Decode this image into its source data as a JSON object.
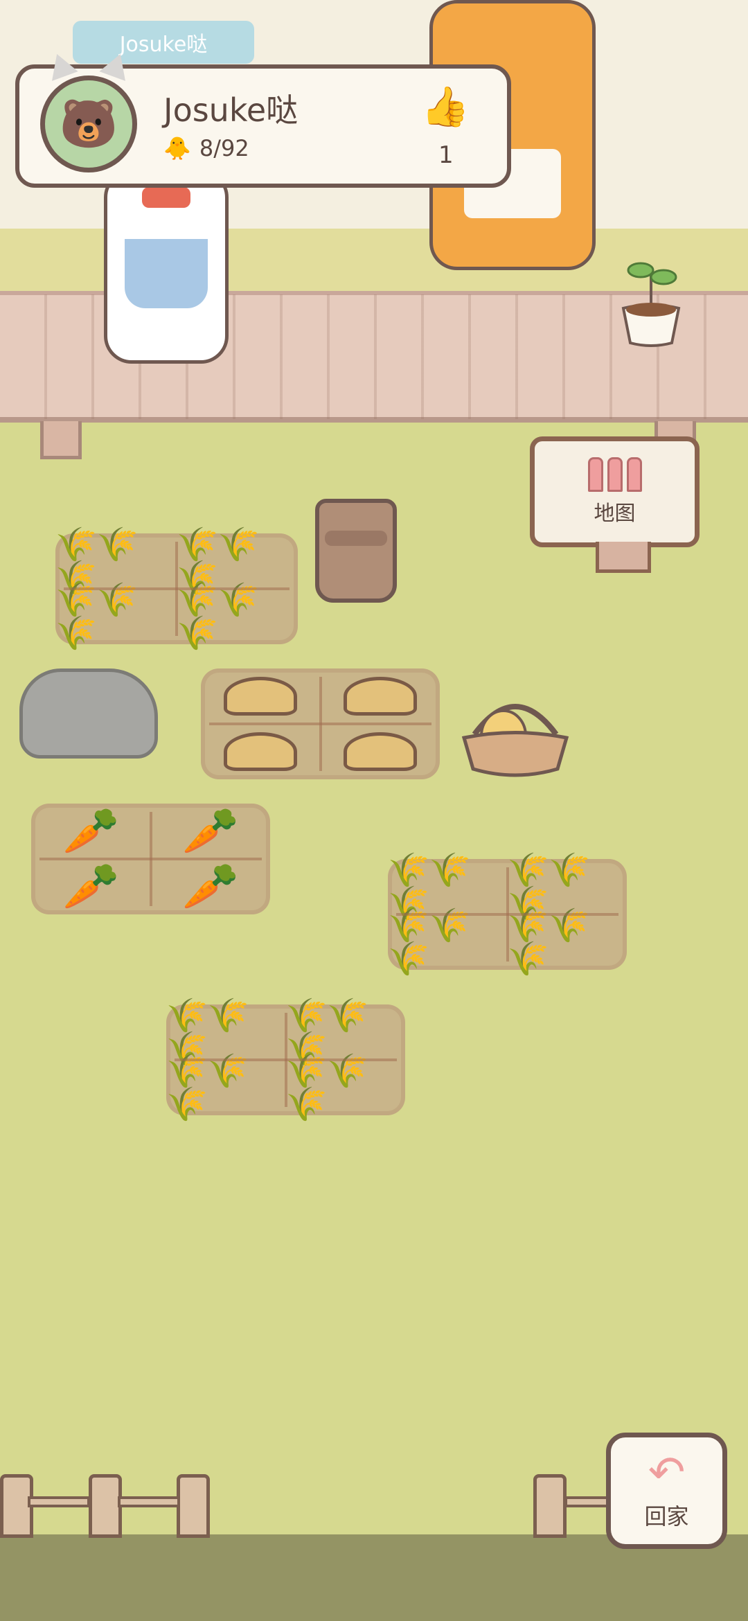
{
  "player": {
    "badge_name": "Josuke哒",
    "name": "Josuke哒",
    "coin_text": "8/92",
    "likes": "1",
    "avatar_icon": "avatar-cat-icon",
    "coin_icon": "coin-icon",
    "like_icon": "thumbs-up-icon"
  },
  "map_sign": {
    "label": "地图",
    "icon": "map-icon"
  },
  "home_button": {
    "label": "回家",
    "icon": "return-arrow-icon"
  },
  "colors": {
    "grass": "#d6d98f",
    "wall": "#f4efe0",
    "fence": "#e6cbbd",
    "soil": "#c9b58a",
    "accent": "#ef9e9e",
    "text": "#5a4740"
  }
}
